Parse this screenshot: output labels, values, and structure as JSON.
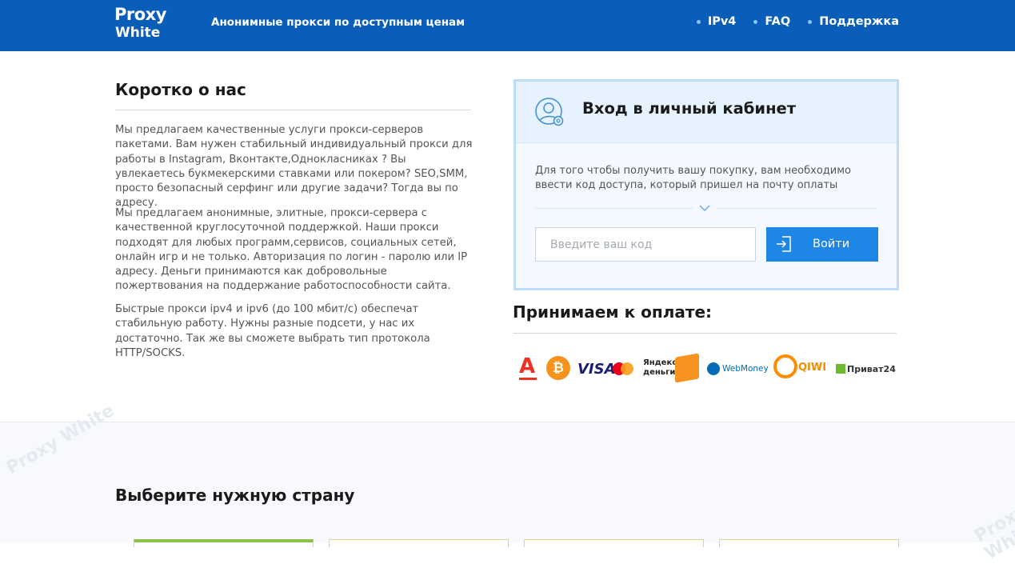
{
  "header": {
    "logo": {
      "line1": "Proxy",
      "line2": "White"
    },
    "tagline": "Анонимные прокси по доступным ценам",
    "nav": [
      {
        "label": "IPv4"
      },
      {
        "label": "FAQ"
      },
      {
        "label": "Поддержка"
      }
    ]
  },
  "about": {
    "title": "Коротко о нас",
    "paragraphs": [
      "Мы предлагаем качественные услуги прокси-серверов пакетами. Вам нужен стабильный индивидуальный прокси для работы в Instagram, Вконтакте,Однокласниках ? Вы увлекаетесь букмекерскими ставками или покером? SEO,SMM, просто безопасный серфинг или другие задачи? Тогда вы по адресу.",
      "Мы предлагаем анонимные, элитные, прокси-сервера с качественной круглосуточной поддержкой. Наши прокси подходят для любых программ,сервисов, социальных сетей, онлайн игр и не только. Авторизация по логин - паролю или IP адресу. Деньги принимаются как добровольные пожертвования на поддержание работоспособности сайта.",
      "Быстрые прокси ipv4 и ipv6 (до 100 мбит/с) обеспечат стабильную работу. Нужны разные подсети, у нас их достаточно. Так же вы сможете выбрать тип протокола HTTP/SOCKS."
    ]
  },
  "login": {
    "title": "Вход в личный кабинет",
    "description": "Для того чтобы получить вашу покупку, вам необходимо ввести код доступа, который пришел на почту оплаты",
    "input_placeholder": "Введите ваш код",
    "input_value": "",
    "button_label": "Войти"
  },
  "payment": {
    "title": "Принимаем к оплате:",
    "methods": [
      {
        "icon": "alfa-bank-icon",
        "label": "А",
        "color": "#ef3124"
      },
      {
        "icon": "bitcoin-icon",
        "label": "₿",
        "color": "#f7931a"
      },
      {
        "icon": "visa-icon",
        "label": "VISA",
        "color": "#1a1f71"
      },
      {
        "icon": "mastercard-icon",
        "label": "MasterCard",
        "color": "#eb001b"
      },
      {
        "icon": "yandex-money-icon",
        "label": "Яндекс деньги",
        "color": "#f79420"
      },
      {
        "icon": "webmoney-icon",
        "label": "WebMoney",
        "color": "#036cb5"
      },
      {
        "icon": "qiwi-icon",
        "label": "QIWI",
        "color": "#ff8c00"
      },
      {
        "icon": "privat24-icon",
        "label": "Приват24",
        "color": "#6fba2c"
      }
    ]
  },
  "country": {
    "title": "Выберите нужную страну",
    "watermark": "Proxy White"
  },
  "colors": {
    "header_bg": "#0a5db8",
    "accent": "#1e87e6",
    "login_border": "#bcdcf7",
    "country_active": "#8bc34a"
  }
}
